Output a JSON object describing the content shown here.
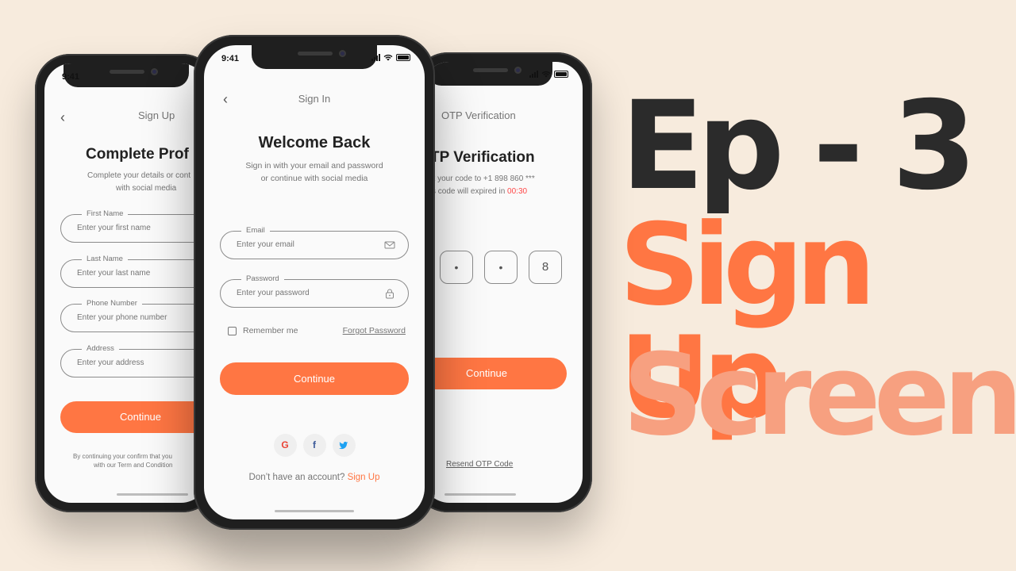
{
  "colors": {
    "background": "#f7ebdd",
    "accent": "#ff7643",
    "accent_light": "#f7a080",
    "dark": "#2b2b2b",
    "timer": "#ff4848"
  },
  "status": {
    "time": "9:41"
  },
  "left_phone": {
    "nav_title": "Sign Up",
    "headline": "Complete Prof",
    "subtext_line1": "Complete your details or cont",
    "subtext_line2": "with social media",
    "fields": [
      {
        "label": "First Name",
        "placeholder": "Enter your first name"
      },
      {
        "label": "Last Name",
        "placeholder": "Enter your last name"
      },
      {
        "label": "Phone Number",
        "placeholder": "Enter your phone number"
      },
      {
        "label": "Address",
        "placeholder": "Enter your address"
      }
    ],
    "continue_label": "Continue",
    "terms_line1": "By continuing your confirm that you",
    "terms_line2": "with our Term and Condition"
  },
  "center_phone": {
    "nav_title": "Sign In",
    "headline": "Welcome Back",
    "subtext_line1": "Sign in with your email and password",
    "subtext_line2": "or continue with social media",
    "email": {
      "label": "Email",
      "placeholder": "Enter your email"
    },
    "password": {
      "label": "Password",
      "placeholder": "Enter your password"
    },
    "remember_label": "Remember me",
    "forgot_label": "Forgot Password",
    "continue_label": "Continue",
    "social": [
      {
        "icon": "google-icon",
        "glyph": "G"
      },
      {
        "icon": "facebook-icon",
        "glyph": "f"
      },
      {
        "icon": "twitter-icon",
        "glyph": "t"
      }
    ],
    "no_account_text": "Don’t have an account?",
    "signup_link": "Sign Up"
  },
  "right_phone": {
    "nav_title": "OTP Verification",
    "headline": "TP Verification",
    "subtext_line1": "nt your code to +1 898 860 ***",
    "subtext_line2_prefix": "s code will expired in",
    "timer": "00:30",
    "otp_digits": [
      "•",
      "•",
      "8"
    ],
    "continue_label": "Continue",
    "resend_label": "Resend OTP Code"
  },
  "title": {
    "line1": "Ep - 3",
    "line2": "Sign Up",
    "line3": "Screen"
  }
}
